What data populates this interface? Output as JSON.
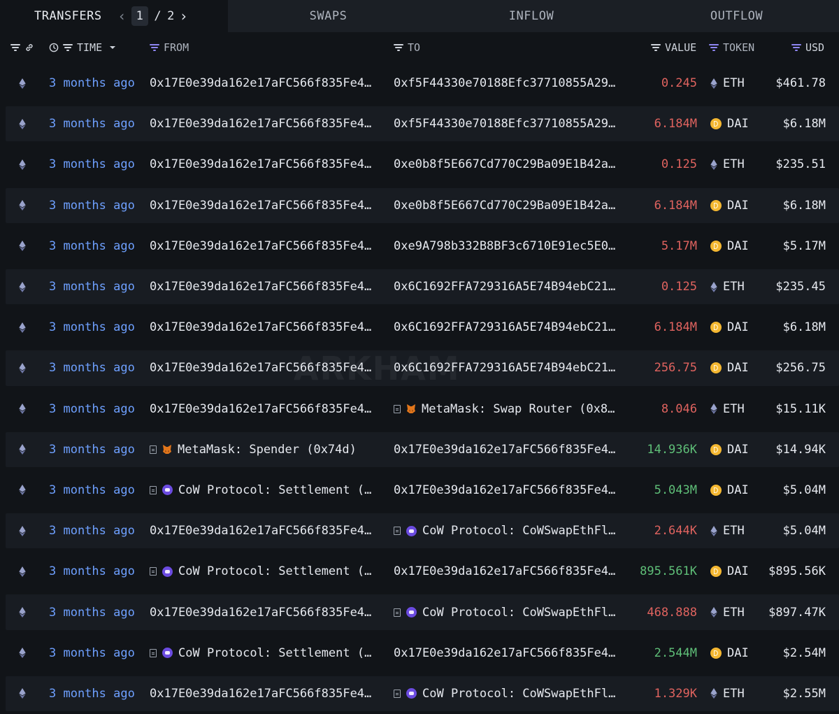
{
  "tabs": {
    "transfers": "TRANSFERS",
    "swaps": "SWAPS",
    "inflow": "INFLOW",
    "outflow": "OUTFLOW"
  },
  "pagination": {
    "current": "1",
    "separator": "/",
    "total": "2"
  },
  "columns": {
    "time": "TIME",
    "from": "FROM",
    "to": "TO",
    "value": "VALUE",
    "token": "TOKEN",
    "usd": "USD"
  },
  "watermark": "ARKHAM",
  "colors": {
    "negative": "#e0635f",
    "positive": "#5fbf78",
    "link": "#6ea0ff",
    "filter_accent": "#8e86f2"
  },
  "rows": [
    {
      "time": "3 months ago",
      "from": {
        "label": "0x17E0e39da162e17aFC566f835Fe4…"
      },
      "to": {
        "label": "0xf5F44330e70188Efc37710855A29…"
      },
      "value": "0.245",
      "direction": "out",
      "token": "ETH",
      "usd": "$461.78"
    },
    {
      "time": "3 months ago",
      "from": {
        "label": "0x17E0e39da162e17aFC566f835Fe4…"
      },
      "to": {
        "label": "0xf5F44330e70188Efc37710855A29…"
      },
      "value": "6.184M",
      "direction": "out",
      "token": "DAI",
      "usd": "$6.18M"
    },
    {
      "time": "3 months ago",
      "from": {
        "label": "0x17E0e39da162e17aFC566f835Fe4…"
      },
      "to": {
        "label": "0xe0b8f5E667Cd770C29Ba09E1B42a…"
      },
      "value": "0.125",
      "direction": "out",
      "token": "ETH",
      "usd": "$235.51"
    },
    {
      "time": "3 months ago",
      "from": {
        "label": "0x17E0e39da162e17aFC566f835Fe4…"
      },
      "to": {
        "label": "0xe0b8f5E667Cd770C29Ba09E1B42a…"
      },
      "value": "6.184M",
      "direction": "out",
      "token": "DAI",
      "usd": "$6.18M"
    },
    {
      "time": "3 months ago",
      "from": {
        "label": "0x17E0e39da162e17aFC566f835Fe4…"
      },
      "to": {
        "label": "0xe9A798b332B8BF3c6710E91ec5E0…"
      },
      "value": "5.17M",
      "direction": "out",
      "token": "DAI",
      "usd": "$5.17M"
    },
    {
      "time": "3 months ago",
      "from": {
        "label": "0x17E0e39da162e17aFC566f835Fe4…"
      },
      "to": {
        "label": "0x6C1692FFA729316A5E74B94ebC21…"
      },
      "value": "0.125",
      "direction": "out",
      "token": "ETH",
      "usd": "$235.45"
    },
    {
      "time": "3 months ago",
      "from": {
        "label": "0x17E0e39da162e17aFC566f835Fe4…"
      },
      "to": {
        "label": "0x6C1692FFA729316A5E74B94ebC21…"
      },
      "value": "6.184M",
      "direction": "out",
      "token": "DAI",
      "usd": "$6.18M"
    },
    {
      "time": "3 months ago",
      "from": {
        "label": "0x17E0e39da162e17aFC566f835Fe4…"
      },
      "to": {
        "label": "0x6C1692FFA729316A5E74B94ebC21…"
      },
      "value": "256.75",
      "direction": "out",
      "token": "DAI",
      "usd": "$256.75"
    },
    {
      "time": "3 months ago",
      "from": {
        "label": "0x17E0e39da162e17aFC566f835Fe4…"
      },
      "to": {
        "label": "MetaMask: Swap Router (0x8…",
        "entity": "metamask"
      },
      "value": "8.046",
      "direction": "out",
      "token": "ETH",
      "usd": "$15.11K"
    },
    {
      "time": "3 months ago",
      "from": {
        "label": "MetaMask: Spender (0x74d)",
        "entity": "metamask"
      },
      "to": {
        "label": "0x17E0e39da162e17aFC566f835Fe4…"
      },
      "value": "14.936K",
      "direction": "in",
      "token": "DAI",
      "usd": "$14.94K"
    },
    {
      "time": "3 months ago",
      "from": {
        "label": "CoW Protocol: Settlement (…",
        "entity": "cow"
      },
      "to": {
        "label": "0x17E0e39da162e17aFC566f835Fe4…"
      },
      "value": "5.043M",
      "direction": "in",
      "token": "DAI",
      "usd": "$5.04M"
    },
    {
      "time": "3 months ago",
      "from": {
        "label": "0x17E0e39da162e17aFC566f835Fe4…"
      },
      "to": {
        "label": "CoW Protocol: CoWSwapEthFl…",
        "entity": "cow"
      },
      "value": "2.644K",
      "direction": "out",
      "token": "ETH",
      "usd": "$5.04M"
    },
    {
      "time": "3 months ago",
      "from": {
        "label": "CoW Protocol: Settlement (…",
        "entity": "cow"
      },
      "to": {
        "label": "0x17E0e39da162e17aFC566f835Fe4…"
      },
      "value": "895.561K",
      "direction": "in",
      "token": "DAI",
      "usd": "$895.56K"
    },
    {
      "time": "3 months ago",
      "from": {
        "label": "0x17E0e39da162e17aFC566f835Fe4…"
      },
      "to": {
        "label": "CoW Protocol: CoWSwapEthFl…",
        "entity": "cow"
      },
      "value": "468.888",
      "direction": "out",
      "token": "ETH",
      "usd": "$897.47K"
    },
    {
      "time": "3 months ago",
      "from": {
        "label": "CoW Protocol: Settlement (…",
        "entity": "cow"
      },
      "to": {
        "label": "0x17E0e39da162e17aFC566f835Fe4…"
      },
      "value": "2.544M",
      "direction": "in",
      "token": "DAI",
      "usd": "$2.54M"
    },
    {
      "time": "3 months ago",
      "from": {
        "label": "0x17E0e39da162e17aFC566f835Fe4…"
      },
      "to": {
        "label": "CoW Protocol: CoWSwapEthFl…",
        "entity": "cow"
      },
      "value": "1.329K",
      "direction": "out",
      "token": "ETH",
      "usd": "$2.55M"
    }
  ]
}
